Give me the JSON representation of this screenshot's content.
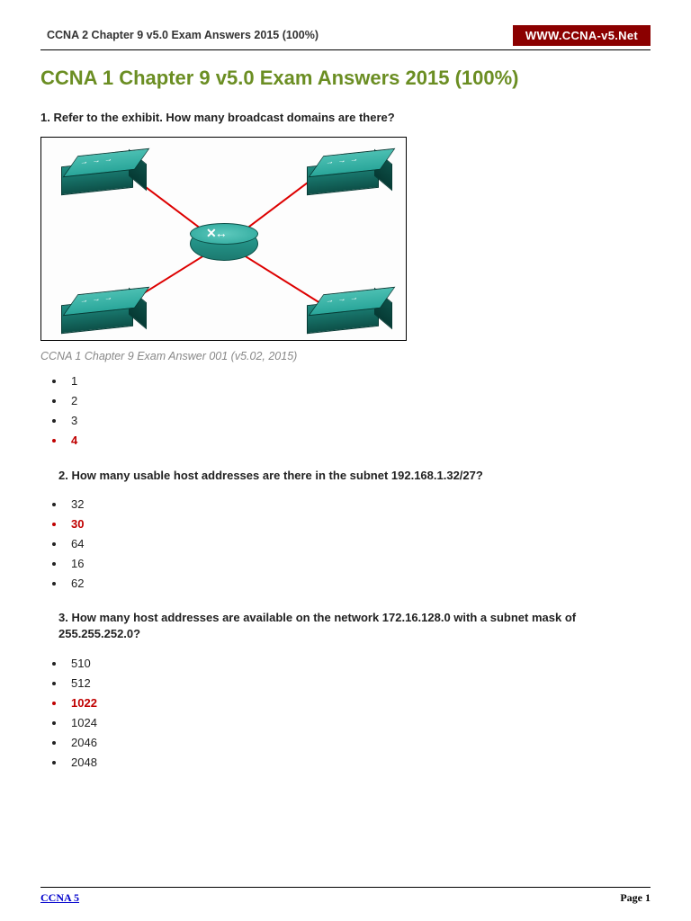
{
  "header": {
    "left": "CCNA 2 Chapter 9 v5.0 Exam Answers 2015 (100%)",
    "right": "WWW.CCNA-v5.Net"
  },
  "title": "CCNA 1 Chapter 9 v5.0 Exam Answers 2015 (100%)",
  "caption": "CCNA 1 Chapter 9 Exam Answer 001 (v5.02, 2015)",
  "questions": [
    {
      "prompt": "1. Refer to the exhibit. How many broadcast domains are there?",
      "options": [
        "1",
        "2",
        "3",
        "4"
      ],
      "correct_index": 3
    },
    {
      "prompt": "2. How many usable host addresses are there in the subnet 192.168.1.32/27?",
      "options": [
        "32",
        "30",
        "64",
        "16",
        "62"
      ],
      "correct_index": 1
    },
    {
      "prompt": "3. How many host addresses are available on the network 172.16.128.0 with a subnet mask of 255.255.252.0?",
      "options": [
        "510",
        "512",
        "1022",
        "1024",
        "2046",
        "2048"
      ],
      "correct_index": 2
    }
  ],
  "footer": {
    "left": "CCNA 5",
    "right": "Page 1"
  }
}
